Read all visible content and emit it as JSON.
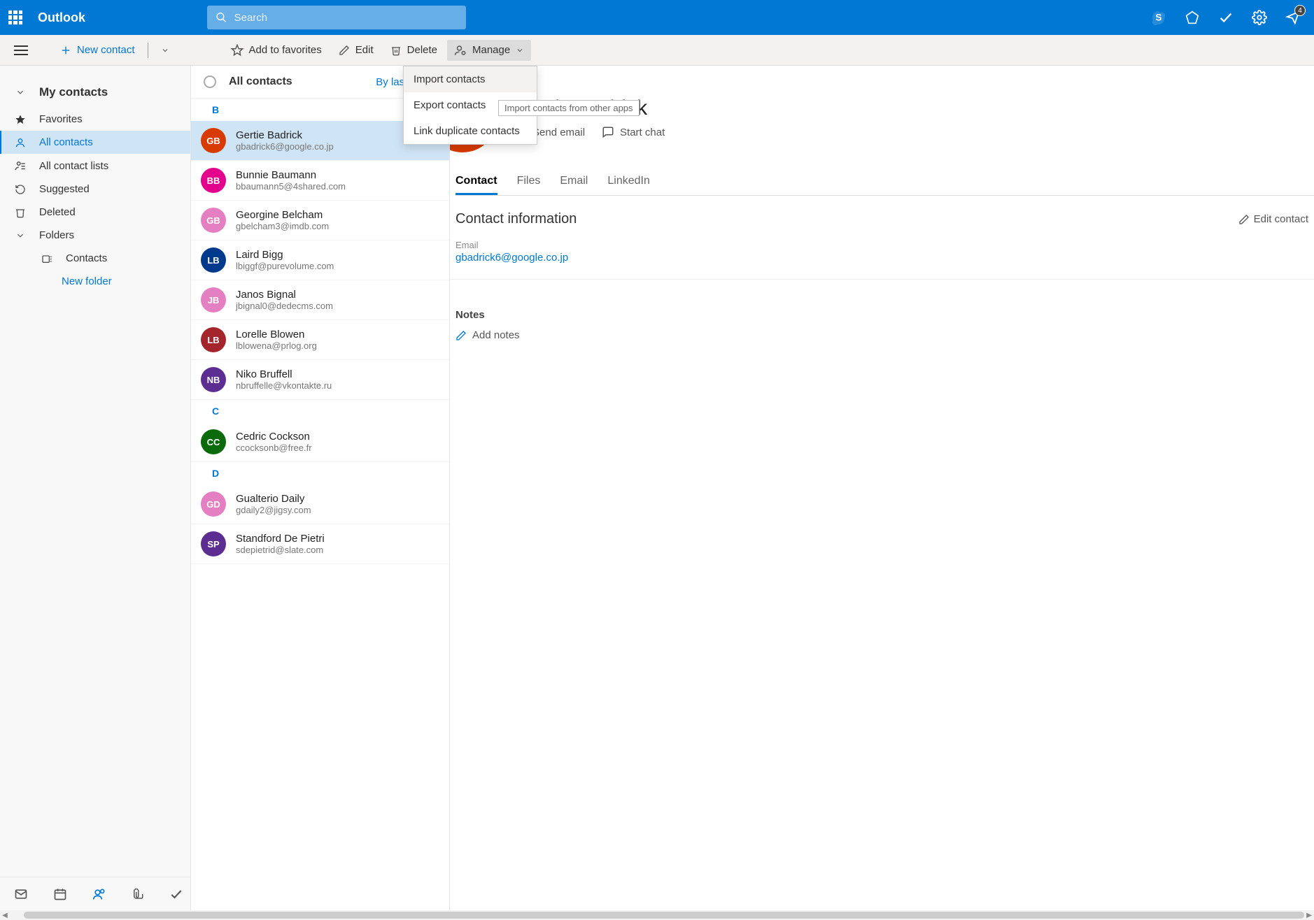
{
  "app_name": "Outlook",
  "search_placeholder": "Search",
  "notification_count": "4",
  "commands": {
    "new_contact": "New contact",
    "add_favorites": "Add to favorites",
    "edit": "Edit",
    "delete": "Delete",
    "manage": "Manage"
  },
  "manage_menu": {
    "import": "Import contacts",
    "export": "Export contacts",
    "link_dup": "Link duplicate contacts",
    "tooltip": "Import contacts from other apps"
  },
  "nav": {
    "header": "My contacts",
    "favorites": "Favorites",
    "all_contacts": "All contacts",
    "all_lists": "All contact lists",
    "suggested": "Suggested",
    "deleted": "Deleted",
    "folders": "Folders",
    "contacts_folder": "Contacts",
    "new_folder": "New folder"
  },
  "list": {
    "title": "All contacts",
    "sort": "By last name",
    "sections": [
      {
        "letter": "B",
        "contacts": [
          {
            "initials": "GB",
            "name": "Gertie Badrick",
            "email": "gbadrick6@google.co.jp",
            "color": "#d83b01",
            "selected": true
          },
          {
            "initials": "BB",
            "name": "Bunnie Baumann",
            "email": "bbaumann5@4shared.com",
            "color": "#e3008c"
          },
          {
            "initials": "GB",
            "name": "Georgine Belcham",
            "email": "gbelcham3@imdb.com",
            "color": "#e480c1"
          },
          {
            "initials": "LB",
            "name": "Laird Bigg",
            "email": "lbiggf@purevolume.com",
            "color": "#003a8c"
          },
          {
            "initials": "JB",
            "name": "Janos Bignal",
            "email": "jbignal0@dedecms.com",
            "color": "#e480c1"
          },
          {
            "initials": "LB",
            "name": "Lorelle Blowen",
            "email": "lblowena@prlog.org",
            "color": "#a4262c"
          },
          {
            "initials": "NB",
            "name": "Niko Bruffell",
            "email": "nbruffelle@vkontakte.ru",
            "color": "#5c2e91"
          }
        ]
      },
      {
        "letter": "C",
        "contacts": [
          {
            "initials": "CC",
            "name": "Cedric Cockson",
            "email": "ccocksonb@free.fr",
            "color": "#0b6a0b"
          }
        ]
      },
      {
        "letter": "D",
        "contacts": [
          {
            "initials": "GD",
            "name": "Gualterio Daily",
            "email": "gdaily2@jigsy.com",
            "color": "#e480c1"
          },
          {
            "initials": "SP",
            "name": "Standford De Pietri",
            "email": "sdepietrid@slate.com",
            "color": "#5c2e91"
          }
        ]
      }
    ]
  },
  "detail": {
    "initials": "GB",
    "name": "Gertie Badrick",
    "send_email": "Send email",
    "start_chat": "Start chat",
    "tabs": {
      "contact": "Contact",
      "files": "Files",
      "email": "Email",
      "linkedin": "LinkedIn"
    },
    "section_title": "Contact information",
    "edit_link": "Edit contact",
    "email_label": "Email",
    "email_value": "gbadrick6@google.co.jp",
    "notes_label": "Notes",
    "add_notes": "Add notes"
  }
}
